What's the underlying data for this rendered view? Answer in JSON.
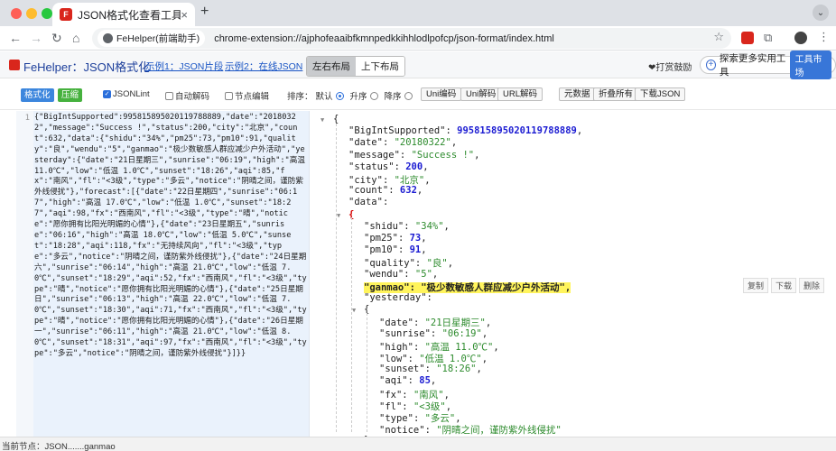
{
  "browser": {
    "tab_title": "JSON格式化查看工具",
    "tab_close": "×",
    "new_tab": "+",
    "chip_label": "FeHelper(前端助手)",
    "url": "chrome-extension://ajphofeaaibfkmnpedkkihhlodlpofcp/json-format/index.html",
    "icons": [
      "back-icon",
      "forward-icon",
      "reload-icon",
      "home-icon",
      "star-icon",
      "puzzle-icon",
      "more-icon"
    ]
  },
  "header": {
    "logo": "FeHelper：JSON格式化",
    "example1": "示例1：JSON片段",
    "example2": "示例2：在线JSON",
    "layout_lr": "左右布局",
    "layout_tb": "上下布局",
    "donate": "❤打赏鼓励",
    "explore": "探索更多实用工具",
    "market": "工具市场"
  },
  "toolbar": {
    "format": "格式化",
    "compress": "压缩",
    "jsonlint": "JSONLint",
    "auto_decode": "自动解码",
    "node_edit": "节点编辑",
    "sort_label": "排序：",
    "sort_default": "默认",
    "sort_asc": "升序",
    "sort_desc": "降序",
    "uni_encode": "Uni编码",
    "uni_decode": "Uni解码",
    "url_decode": "URL解码",
    "raw_data": "元数据",
    "collapse_all": "折叠所有",
    "download_json": "下载JSON"
  },
  "editor": {
    "line_no": "1",
    "content": "{\"BigIntSupported\":995815895020119788889,\"date\":\"20180322\",\"message\":\"Success !\",\"status\":200,\"city\":\"北京\",\"count\":632,\"data\":{\"shidu\":\"34%\",\"pm25\":73,\"pm10\":91,\"quality\":\"良\",\"wendu\":\"5\",\"ganmao\":\"极少数敏感人群应减少户外活动\",\"yesterday\":{\"date\":\"21日星期三\",\"sunrise\":\"06:19\",\"high\":\"高温 11.0℃\",\"low\":\"低温 1.0℃\",\"sunset\":\"18:26\",\"aqi\":85,\"fx\":\"南风\",\"fl\":\"<3级\",\"type\":\"多云\",\"notice\":\"阴晴之间，谨防紫外线侵扰\"},\"forecast\":[{\"date\":\"22日星期四\",\"sunrise\":\"06:17\",\"high\":\"高温 17.0℃\",\"low\":\"低温 1.0℃\",\"sunset\":\"18:27\",\"aqi\":98,\"fx\":\"西南风\",\"fl\":\"<3级\",\"type\":\"晴\",\"notice\":\"愿你拥有比阳光明媚的心情\"},{\"date\":\"23日星期五\",\"sunrise\":\"06:16\",\"high\":\"高温 18.0℃\",\"low\":\"低温 5.0℃\",\"sunset\":\"18:28\",\"aqi\":118,\"fx\":\"无持续风向\",\"fl\":\"<3级\",\"type\":\"多云\",\"notice\":\"阴晴之间，谨防紫外线侵扰\"},{\"date\":\"24日星期六\",\"sunrise\":\"06:14\",\"high\":\"高温 21.0℃\",\"low\":\"低温 7.0℃\",\"sunset\":\"18:29\",\"aqi\":52,\"fx\":\"西南风\",\"fl\":\"<3级\",\"type\":\"晴\",\"notice\":\"愿你拥有比阳光明媚的心情\"},{\"date\":\"25日星期日\",\"sunrise\":\"06:13\",\"high\":\"高温 22.0℃\",\"low\":\"低温 7.0℃\",\"sunset\":\"18:30\",\"aqi\":71,\"fx\":\"西南风\",\"fl\":\"<3级\",\"type\":\"晴\",\"notice\":\"愿你拥有比阳光明媚的心情\"},{\"date\":\"26日星期一\",\"sunrise\":\"06:11\",\"high\":\"高温 21.0℃\",\"low\":\"低温 8.0℃\",\"sunset\":\"18:31\",\"aqi\":97,\"fx\":\"西南风\",\"fl\":\"<3级\",\"type\":\"多云\",\"notice\":\"阴晴之间，谨防紫外线侵扰\"}]}}"
  },
  "tree": {
    "open_brace": "{",
    "lines": [
      {
        "key": "\"BigIntSupported\"",
        "val": "995815895020119788889",
        "vtype": "n",
        "comma": ","
      },
      {
        "key": "\"date\"",
        "val": "\"20180322\"",
        "vtype": "s",
        "comma": ","
      },
      {
        "key": "\"message\"",
        "val": "\"Success !\"",
        "vtype": "s",
        "comma": ","
      },
      {
        "key": "\"status\"",
        "val": "200",
        "vtype": "n",
        "comma": ","
      },
      {
        "key": "\"city\"",
        "val": "\"北京\"",
        "vtype": "s",
        "comma": ","
      },
      {
        "key": "\"count\"",
        "val": "632",
        "vtype": "n",
        "comma": ","
      },
      {
        "key": "\"data\"",
        "val": "",
        "vtype": "",
        "comma": ""
      }
    ],
    "data_brace": "{",
    "data_lines": [
      {
        "key": "\"shidu\"",
        "val": "\"34%\"",
        "vtype": "s",
        "comma": ","
      },
      {
        "key": "\"pm25\"",
        "val": "73",
        "vtype": "n",
        "comma": ","
      },
      {
        "key": "\"pm10\"",
        "val": "91",
        "vtype": "n",
        "comma": ","
      },
      {
        "key": "\"quality\"",
        "val": "\"良\"",
        "vtype": "s",
        "comma": ","
      },
      {
        "key": "\"wendu\"",
        "val": "\"5\"",
        "vtype": "s",
        "comma": ","
      },
      {
        "key": "\"ganmao\"",
        "val": "\"极少数敏感人群应减少户外活动\"",
        "vtype": "hl",
        "comma": ","
      },
      {
        "key": "\"yesterday\"",
        "val": "",
        "vtype": "",
        "comma": ""
      }
    ],
    "yesterday_brace": "{",
    "yesterday_lines": [
      {
        "key": "\"date\"",
        "val": "\"21日星期三\"",
        "vtype": "s",
        "comma": ","
      },
      {
        "key": "\"sunrise\"",
        "val": "\"06:19\"",
        "vtype": "s",
        "comma": ","
      },
      {
        "key": "\"high\"",
        "val": "\"高温 11.0℃\"",
        "vtype": "s",
        "comma": ","
      },
      {
        "key": "\"low\"",
        "val": "\"低温 1.0℃\"",
        "vtype": "s",
        "comma": ","
      },
      {
        "key": "\"sunset\"",
        "val": "\"18:26\"",
        "vtype": "s",
        "comma": ","
      },
      {
        "key": "\"aqi\"",
        "val": "85",
        "vtype": "n",
        "comma": ","
      },
      {
        "key": "\"fx\"",
        "val": "\"南风\"",
        "vtype": "s",
        "comma": ","
      },
      {
        "key": "\"fl\"",
        "val": "\"<3级\"",
        "vtype": "s",
        "comma": ","
      },
      {
        "key": "\"type\"",
        "val": "\"多云\"",
        "vtype": "s",
        "comma": ","
      },
      {
        "key": "\"notice\"",
        "val": "\"阴晴之间，谨防紫外线侵扰\"",
        "vtype": "s",
        "comma": ""
      }
    ],
    "close_brace": "}",
    "row_ops": {
      "copy": "复制",
      "download": "下载",
      "delete": "删除"
    }
  },
  "status": {
    "text": "当前节点：JSON.......ganmao"
  },
  "colors": {
    "string": "#2d8b2d",
    "number": "#1b1bd2",
    "accent": "#3c86dd",
    "highlight": "#fff45c"
  }
}
